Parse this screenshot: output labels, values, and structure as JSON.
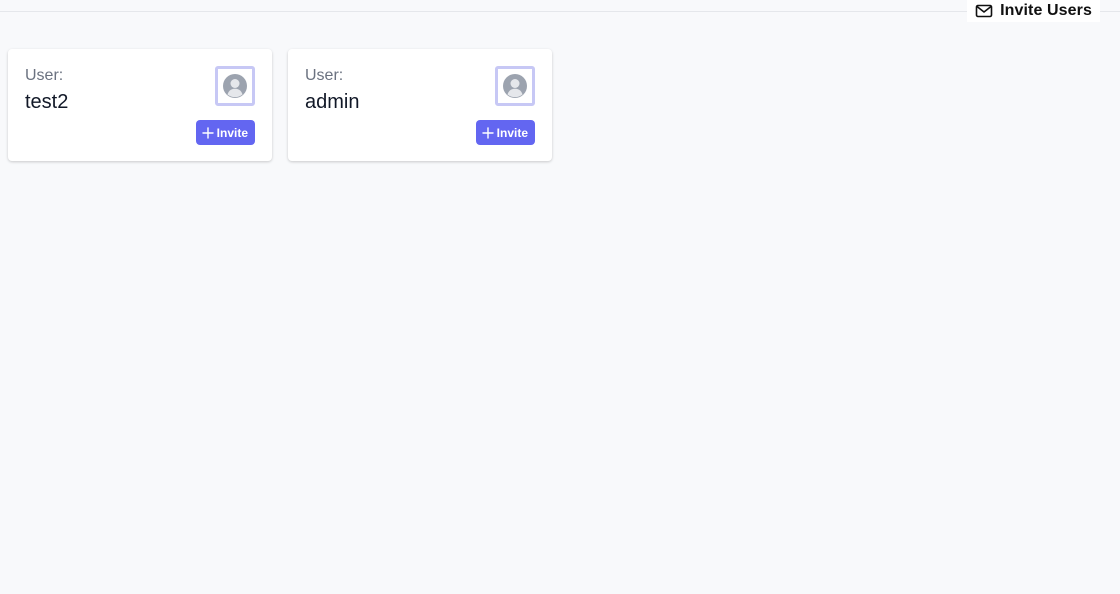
{
  "header": {
    "invite_users_label": "Invite Users",
    "invite_users_icon": "mail-icon"
  },
  "cards": [
    {
      "user_label": "User:",
      "user_name": "test2",
      "avatar_icon": "user-avatar-icon",
      "invite_label": "Invite",
      "invite_icon": "plus-icon"
    },
    {
      "user_label": "User:",
      "user_name": "admin",
      "avatar_icon": "user-avatar-icon",
      "invite_label": "Invite",
      "invite_icon": "plus-icon"
    }
  ],
  "colors": {
    "accent": "#6366f1",
    "avatar_border": "#c7c8f5",
    "background": "#f8f9fb",
    "muted_text": "#6b7280"
  }
}
